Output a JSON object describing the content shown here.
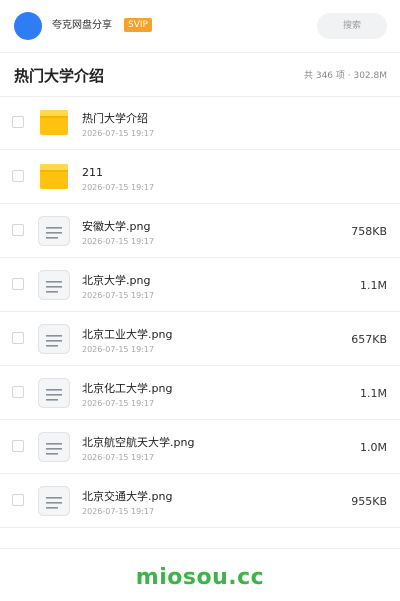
{
  "topbar": {
    "app_name": "夸克网盘分享",
    "badge": "SVIP",
    "search_placeholder": "搜索",
    "colors": {
      "avatar": "#2f7df6",
      "badge": "#f5a12c"
    }
  },
  "header": {
    "title": "热门大学介绍",
    "summary": "共 346 项 · 302.8M"
  },
  "files": [
    {
      "name": "热门大学介绍",
      "date": "2026-07-15 19:17",
      "size": "",
      "type": "folder",
      "icon": "folder-icon"
    },
    {
      "name": "211",
      "date": "2026-07-15 19:17",
      "size": "",
      "type": "folder",
      "icon": "folder-icon"
    },
    {
      "name": "安徽大学.png",
      "date": "2026-07-15 19:17",
      "size": "758KB",
      "type": "file",
      "icon": "document-icon"
    },
    {
      "name": "北京大学.png",
      "date": "2026-07-15 19:17",
      "size": "1.1M",
      "type": "file",
      "icon": "document-icon"
    },
    {
      "name": "北京工业大学.png",
      "date": "2026-07-15 19:17",
      "size": "657KB",
      "type": "file",
      "icon": "document-icon"
    },
    {
      "name": "北京化工大学.png",
      "date": "2026-07-15 19:17",
      "size": "1.1M",
      "type": "file",
      "icon": "document-icon"
    },
    {
      "name": "北京航空航天大学.png",
      "date": "2026-07-15 19:17",
      "size": "1.0M",
      "type": "file",
      "icon": "document-icon"
    },
    {
      "name": "北京交通大学.png",
      "date": "2026-07-15 19:17",
      "size": "955KB",
      "type": "file",
      "icon": "document-icon"
    }
  ],
  "footer": {
    "brand": "miosou.cc",
    "color": "#3db44a"
  }
}
